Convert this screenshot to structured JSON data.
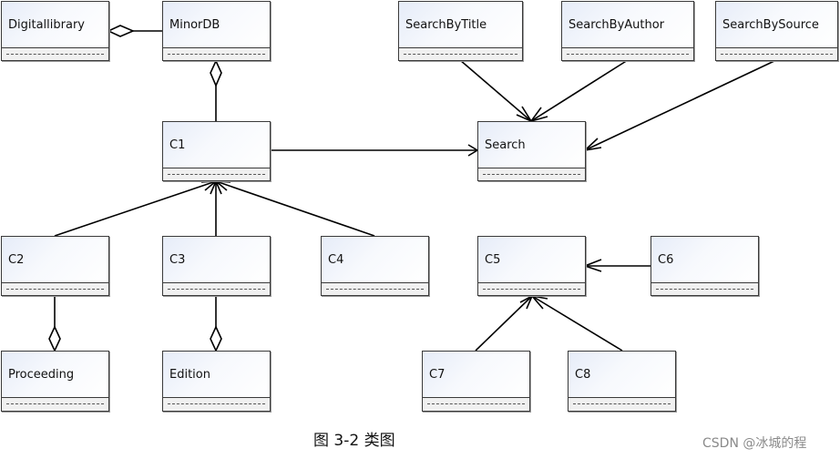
{
  "diagram": {
    "type": "uml-class-diagram",
    "classes": [
      {
        "id": "digitallibrary",
        "name": "Digitallibrary"
      },
      {
        "id": "minordb",
        "name": "MinorDB"
      },
      {
        "id": "searchbytitle",
        "name": "SearchByTitle"
      },
      {
        "id": "searchbyauthor",
        "name": "SearchByAuthor"
      },
      {
        "id": "searchbysource",
        "name": "SearchBySource"
      },
      {
        "id": "c1",
        "name": "C1"
      },
      {
        "id": "search",
        "name": "Search"
      },
      {
        "id": "c2",
        "name": "C2"
      },
      {
        "id": "c3",
        "name": "C3"
      },
      {
        "id": "c4",
        "name": "C4"
      },
      {
        "id": "c5",
        "name": "C5"
      },
      {
        "id": "c6",
        "name": "C6"
      },
      {
        "id": "proceeding",
        "name": "Proceeding"
      },
      {
        "id": "edition",
        "name": "Edition"
      },
      {
        "id": "c7",
        "name": "C7"
      },
      {
        "id": "c8",
        "name": "C8"
      }
    ],
    "relations": [
      {
        "type": "aggregation",
        "whole": "Digitallibrary",
        "part": "MinorDB"
      },
      {
        "type": "aggregation",
        "whole": "MinorDB",
        "part": "C1"
      },
      {
        "type": "association",
        "from": "C1",
        "to": "Search"
      },
      {
        "type": "association",
        "from": "SearchByTitle",
        "to": "Search"
      },
      {
        "type": "association",
        "from": "SearchByAuthor",
        "to": "Search"
      },
      {
        "type": "association",
        "from": "SearchBySource",
        "to": "Search"
      },
      {
        "type": "association",
        "from": "C2",
        "to": "C1"
      },
      {
        "type": "association",
        "from": "C3",
        "to": "C1"
      },
      {
        "type": "association",
        "from": "C4",
        "to": "C1"
      },
      {
        "type": "aggregation",
        "whole": "Proceeding",
        "part": "C2"
      },
      {
        "type": "aggregation",
        "whole": "Edition",
        "part": "C3"
      },
      {
        "type": "association",
        "from": "C6",
        "to": "C5"
      },
      {
        "type": "association",
        "from": "C7",
        "to": "C5"
      },
      {
        "type": "association",
        "from": "C8",
        "to": "C5"
      }
    ]
  },
  "caption": "图 3-2 类图",
  "watermark": "CSDN @冰城的程",
  "colors": {
    "line": "#000000",
    "box_border": "#3a3a3a",
    "attr_strip": "#f0f0f0",
    "name_gradient_start": "#e6ecf8"
  }
}
